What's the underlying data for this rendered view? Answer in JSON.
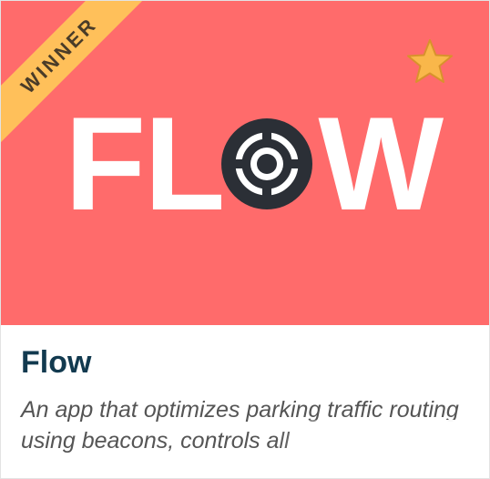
{
  "card": {
    "badge": "WINNER",
    "logo": {
      "left_text": "FL",
      "right_text": "W",
      "o_icon": "target-icon"
    },
    "favorite_icon": "star-icon",
    "title": "Flow",
    "description": "An app that optimizes parking traffic routing using beacons, controls all"
  },
  "colors": {
    "thumbnail_bg": "#ff6b6b",
    "ribbon": "#ffc05a",
    "star": "#f9b74a",
    "logo_dark": "#2b2f36",
    "title": "#123a4f",
    "description": "#555555"
  }
}
